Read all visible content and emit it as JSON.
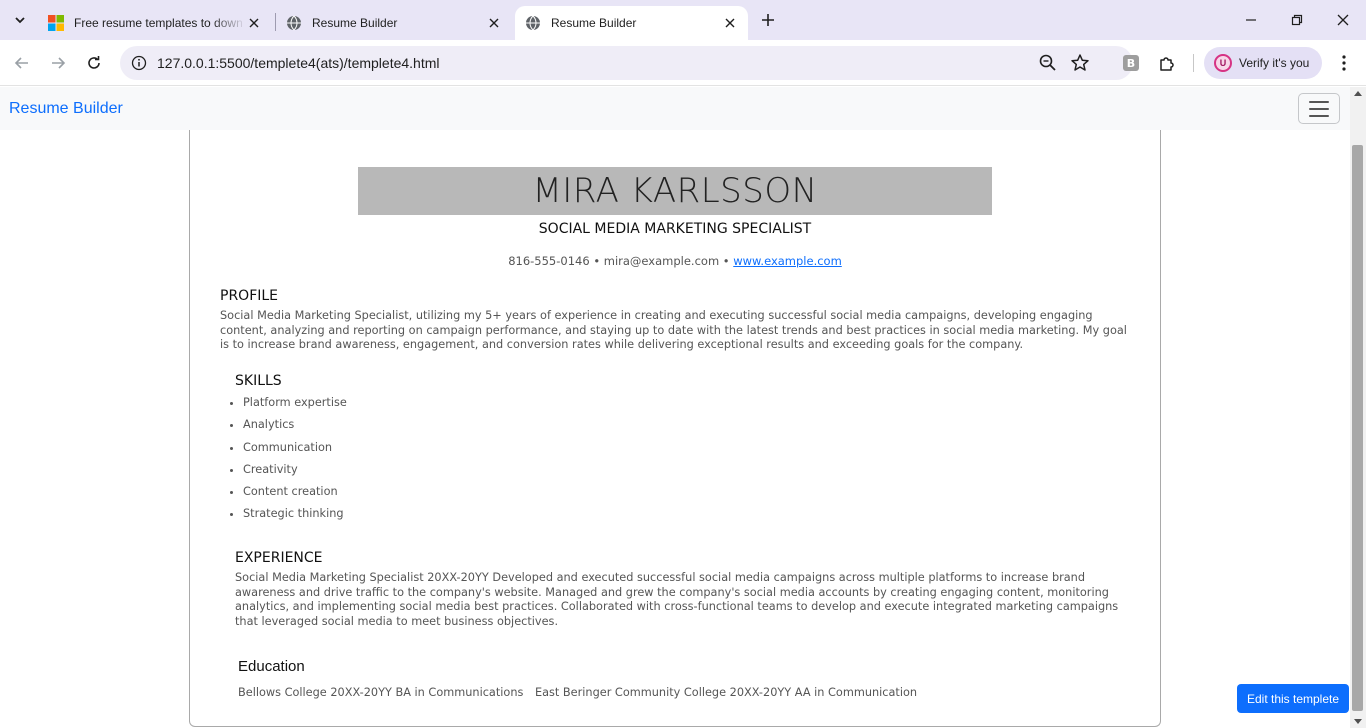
{
  "browser": {
    "tabs": [
      {
        "title": "Free resume templates to down",
        "icon": "microsoft-logo-icon"
      },
      {
        "title": "Resume Builder",
        "icon": "globe-icon"
      },
      {
        "title": "Resume Builder",
        "icon": "globe-icon",
        "active": true
      }
    ],
    "url": "127.0.0.1:5500/templete4(ats)/templete4.html",
    "profile_label": "Verify it's you",
    "profile_initial": "U"
  },
  "navbar": {
    "brand": "Resume Builder"
  },
  "resume": {
    "name": "MIRA KARLSSON",
    "title": "SOCIAL MEDIA MARKETING SPECIALIST",
    "contact_text": "816-555-0146 • mira@example.com •",
    "website": "www.example.com",
    "profile_heading": "PROFILE",
    "profile_text": "Social Media Marketing Specialist, utilizing my 5+ years of experience in creating and executing successful social media campaigns, developing engaging content, analyzing and reporting on campaign performance, and staying up to date with the latest trends and best practices in social media marketing. My goal is to increase brand awareness, engagement, and conversion rates while delivering exceptional results and exceeding goals for the company.",
    "skills_heading": "SKILLS",
    "skills": [
      "Platform expertise",
      "Analytics",
      "Communication",
      "Creativity",
      "Content creation",
      "Strategic thinking"
    ],
    "experience_heading": "EXPERIENCE",
    "experience_text": "Social Media Marketing Specialist 20XX-20YY Developed and executed successful social media campaigns across multiple platforms to increase brand awareness and drive traffic to the company's website. Managed and grew the company's social media accounts by creating engaging content, monitoring analytics, and implementing social media best practices. Collaborated with cross-functional teams to develop and execute integrated marketing campaigns that leveraged social media to meet business objectives.",
    "education_heading": "Education",
    "education": [
      "Bellows College 20XX-20YY BA in Communications",
      "East Beringer Community College 20XX-20YY AA in Communication"
    ]
  },
  "edit_button": "Edit this templete",
  "colors": {
    "accent": "#0d6efd",
    "name_box": "#b8b8b8",
    "tab_strip": "#e8e5f6"
  }
}
